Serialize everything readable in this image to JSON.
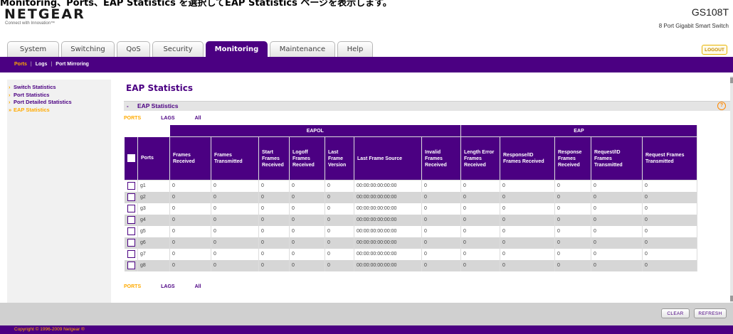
{
  "header": {
    "top_text": "Monitoring、Ports、EAP Statistics を選択してEAP Statistics ページを表示します。",
    "logo": "NETGEAR",
    "tagline": "Connect with Innovation™",
    "model": "GS108T",
    "model_subtitle": "8 Port Gigabit Smart Switch",
    "logout": "LOGOUT"
  },
  "tabs": [
    "System",
    "Switching",
    "QoS",
    "Security",
    "Monitoring",
    "Maintenance",
    "Help"
  ],
  "subnav": {
    "items": [
      "Ports",
      "Logs",
      "Port Mirroring"
    ],
    "separator": "|"
  },
  "leftnav": {
    "items": [
      "Switch Statistics",
      "Port Statistics",
      "Port Detailed Statistics",
      "EAP Statistics"
    ]
  },
  "page": {
    "title": "EAP Statistics",
    "section": "EAP Statistics",
    "minus_icon": "-",
    "info_icon": "?"
  },
  "filters": [
    "PORTS",
    "LAGS",
    "All"
  ],
  "table": {
    "group_eapol": "EAPOL",
    "group_eap": "EAP",
    "ports_header": "Ports",
    "columns": [
      "Frames Received",
      "Frames Transmitted",
      "Start Frames Received",
      "Logoff Frames Received",
      "Last Frame Version",
      "Last Frame Source",
      "Invalid Frames Received",
      "Length Error Frames Received",
      "Response/ID Frames Received",
      "Response Frames Received",
      "Request/ID Frames Transmitted",
      "Request Frames Transmitted"
    ],
    "rows": [
      {
        "port": "g1",
        "values": [
          "0",
          "0",
          "0",
          "0",
          "0",
          "00:00:00:00:00:00",
          "0",
          "0",
          "0",
          "0",
          "0",
          "0"
        ]
      },
      {
        "port": "g2",
        "values": [
          "0",
          "0",
          "0",
          "0",
          "0",
          "00:00:00:00:00:00",
          "0",
          "0",
          "0",
          "0",
          "0",
          "0"
        ]
      },
      {
        "port": "g3",
        "values": [
          "0",
          "0",
          "0",
          "0",
          "0",
          "00:00:00:00:00:00",
          "0",
          "0",
          "0",
          "0",
          "0",
          "0"
        ]
      },
      {
        "port": "g4",
        "values": [
          "0",
          "0",
          "0",
          "0",
          "0",
          "00:00:00:00:00:00",
          "0",
          "0",
          "0",
          "0",
          "0",
          "0"
        ]
      },
      {
        "port": "g5",
        "values": [
          "0",
          "0",
          "0",
          "0",
          "0",
          "00:00:00:00:00:00",
          "0",
          "0",
          "0",
          "0",
          "0",
          "0"
        ]
      },
      {
        "port": "g6",
        "values": [
          "0",
          "0",
          "0",
          "0",
          "0",
          "00:00:00:00:00:00",
          "0",
          "0",
          "0",
          "0",
          "0",
          "0"
        ]
      },
      {
        "port": "g7",
        "values": [
          "0",
          "0",
          "0",
          "0",
          "0",
          "00:00:00:00:00:00",
          "0",
          "0",
          "0",
          "0",
          "0",
          "0"
        ]
      },
      {
        "port": "g8",
        "values": [
          "0",
          "0",
          "0",
          "0",
          "0",
          "00:00:00:00:00:00",
          "0",
          "0",
          "0",
          "0",
          "0",
          "0"
        ]
      }
    ]
  },
  "buttons": {
    "clear": "CLEAR",
    "refresh": "REFRESH"
  },
  "copyright": "Copyright © 1996-2009 Netgear ®",
  "colors": {
    "brand_purple": "#4b0082",
    "accent_orange": "#ffaa00"
  }
}
